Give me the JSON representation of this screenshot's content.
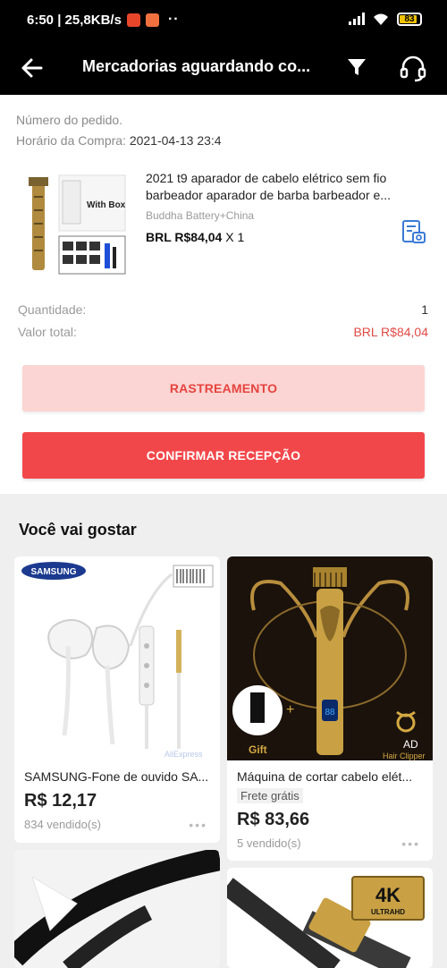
{
  "status_bar": {
    "time_speed": "6:50 | 25,8KB/s",
    "dots": "··",
    "battery": "83"
  },
  "header": {
    "title": "Mercadorias aguardando co..."
  },
  "order": {
    "order_number_label": "Número do pedido.",
    "purchase_time_label": "Horário da Compra:",
    "purchase_time_value": "2021-04-13 23:4",
    "product": {
      "title": "2021 t9 aparador de cabelo elétrico sem fio barbeador aparador de barba barbeador e...",
      "variant": "Buddha Battery+China",
      "price": "BRL R$84,04",
      "qty": "X 1",
      "thumb_label": "With Box"
    },
    "quantity_label": "Quantidade:",
    "quantity_value": "1",
    "total_label": "Valor total:",
    "total_value": "BRL R$84,04",
    "tracking_button": "RASTREAMENTO",
    "confirm_button": "CONFIRMAR RECEPÇÃO"
  },
  "recommendations": {
    "title": "Você vai gostar",
    "items": [
      {
        "name": "SAMSUNG-Fone de ouvido SA...",
        "price": "R$ 12,17",
        "sold": "834  vendido(s)",
        "brand": "SAMSUNG",
        "watermark": "AliExpress"
      },
      {
        "name": "Máquina de cortar cabelo elét...",
        "shipping": "Frete grátis",
        "price": "R$ 83,66",
        "sold": "5  vendido(s)",
        "badge_ad": "AD",
        "gift_label": "Gift",
        "img_caption": "Hair Clipper"
      },
      {
        "name": ""
      },
      {
        "name": "",
        "badge_4k": "4K",
        "badge_uhd": "ULTRAHD"
      }
    ]
  },
  "colors": {
    "accent_red": "#f2474a",
    "light_red": "#fbd5d3",
    "price_red": "#e04a45"
  }
}
